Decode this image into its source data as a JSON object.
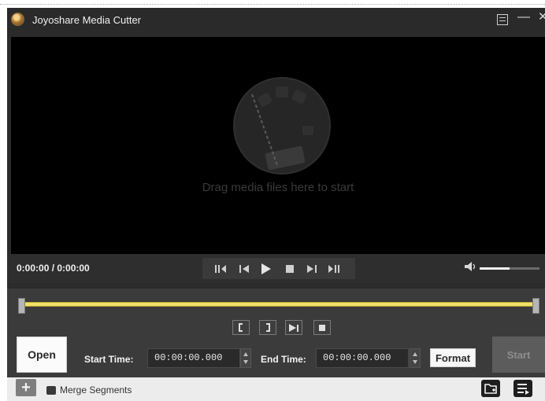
{
  "window": {
    "title": "Joyoshare Media Cutter"
  },
  "player": {
    "drop_hint": "Drag media files here to start",
    "time_readout": "0:00:00 / 0:00:00",
    "volume_level": 0.5
  },
  "editor": {
    "open_label": "Open",
    "start_time_label": "Start Time:",
    "start_time_value": "00:00:00.000",
    "end_time_label": "End Time:",
    "end_time_value": "00:00:00.000",
    "format_label": "Format",
    "start_label": "Start",
    "merge_label": "Merge Segments"
  },
  "colors": {
    "timeline": "#efe16a",
    "window_bg": "#2b2b2b",
    "video_bg": "#000000"
  },
  "icons": {
    "playback": [
      "previous-segment-icon",
      "step-back-icon",
      "play-icon",
      "stop-icon",
      "step-forward-icon",
      "next-segment-icon"
    ],
    "cut_tools": [
      "mark-in-icon",
      "mark-out-icon",
      "play-segment-icon",
      "stop-segment-icon"
    ],
    "bottom_right": [
      "output-folder-icon",
      "segment-list-icon"
    ]
  }
}
